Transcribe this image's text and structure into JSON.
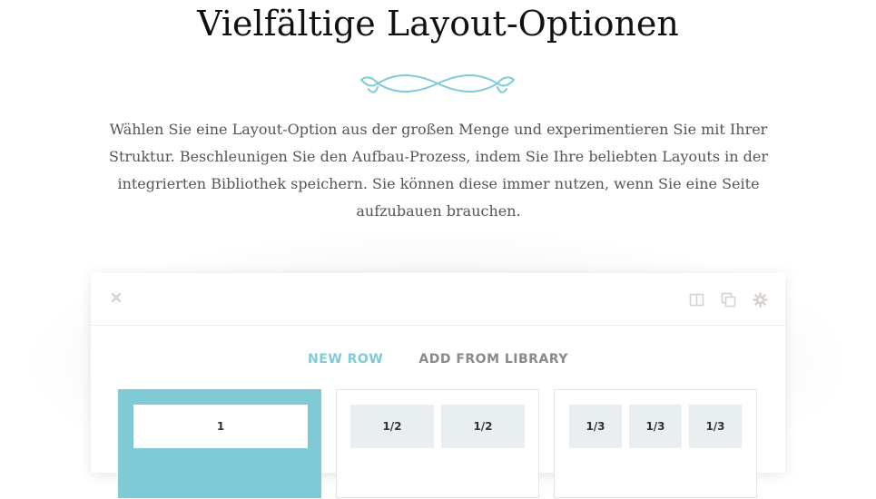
{
  "heading": "Vielfältige Layout-Optionen",
  "intro": "Wählen Sie eine Layout-Option aus der großen Menge und experimentieren Sie mit Ihrer Struktur. Beschleunigen Sie den Aufbau-Prozess, indem Sie Ihre beliebten Layouts in der integrierten Bibliothek speichern. Sie können diese immer nutzen, wenn Sie eine Seite aufzubauen brauchen.",
  "colors": {
    "accent": "#7ecbd6",
    "cell": "#e9eff0",
    "icon": "#d9d2cc"
  },
  "panel": {
    "toolbar": {
      "icons": [
        "close-icon",
        "columns-icon",
        "copy-icon",
        "gear-icon"
      ]
    },
    "tabs": {
      "new_row": "NEW ROW",
      "add_from_library": "ADD FROM LIBRARY",
      "active": "new_row"
    },
    "layouts": [
      {
        "cells": [
          "1"
        ],
        "selected": true
      },
      {
        "cells": [
          "1/2",
          "1/2"
        ],
        "selected": false
      },
      {
        "cells": [
          "1/3",
          "1/3",
          "1/3"
        ],
        "selected": false
      }
    ]
  }
}
